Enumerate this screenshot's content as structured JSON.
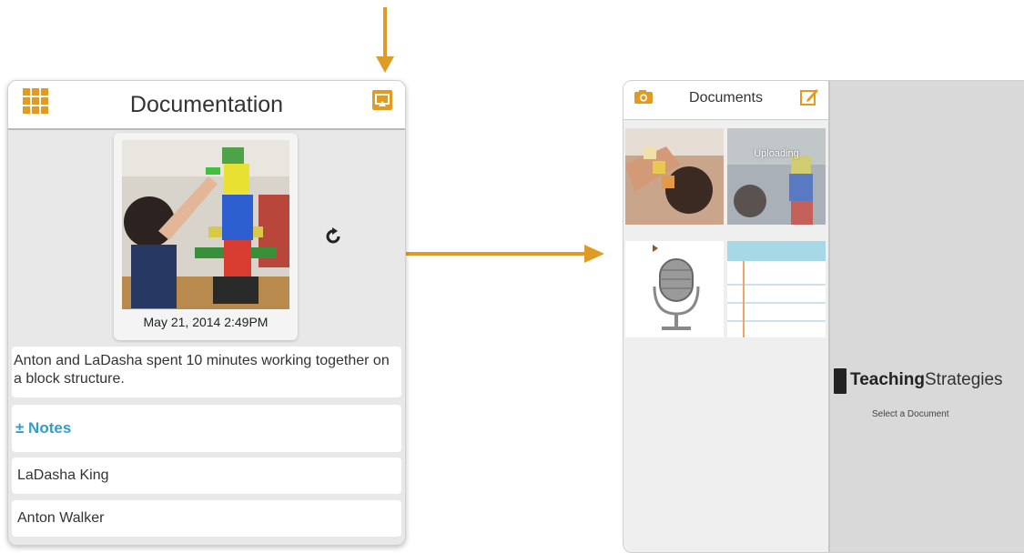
{
  "colors": {
    "accent": "#e39a1f",
    "link": "#2e9fc7",
    "arrow": "#e09a26"
  },
  "left_panel": {
    "title": "Documentation",
    "grid_icon": "grid-menu-icon",
    "share_icon": "share-upload-icon",
    "photo": {
      "date": "May 21, 2014 2:49PM"
    },
    "rotate_icon": "rotate-icon",
    "caption": "Anton and LaDasha spent 10 minutes working together on a block structure.",
    "notes_label": "± Notes",
    "children": [
      "LaDasha King",
      "Anton Walker"
    ]
  },
  "right_panel": {
    "title": "Documents",
    "camera_icon": "camera-icon",
    "edit_icon": "edit-icon",
    "thumbnails": [
      {
        "type": "photo",
        "status": ""
      },
      {
        "type": "photo",
        "status": "Uploading"
      },
      {
        "type": "audio",
        "status": ""
      },
      {
        "type": "note",
        "status": ""
      }
    ],
    "brand_bold": "Teaching",
    "brand_light": "Strategies",
    "empty_message": "Select a Document"
  }
}
